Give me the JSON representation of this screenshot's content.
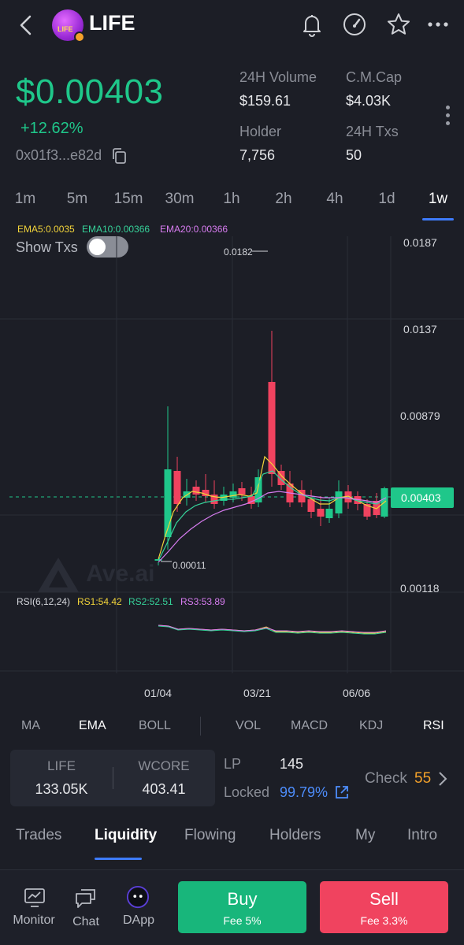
{
  "token": {
    "symbol": "LIFE",
    "logo_text": "LIFE",
    "price": "$0.00403",
    "change": "+12.62%",
    "address": "0x01f3...e82d"
  },
  "stats": {
    "volume_label": "24H Volume",
    "volume_value": "$159.61",
    "cap_label": "C.M.Cap",
    "cap_value": "$4.03K",
    "holder_label": "Holder",
    "holder_value": "7,756",
    "txs_label": "24H Txs",
    "txs_value": "50"
  },
  "timeframes": [
    "1m",
    "5m",
    "15m",
    "30m",
    "1h",
    "2h",
    "4h",
    "1d",
    "1w"
  ],
  "active_timeframe": "1w",
  "chart": {
    "show_txs_label": "Show Txs",
    "ema5": "EMA5:0.0035",
    "ema10": "EMA10:0.00366",
    "ema20": "EMA20:0.00366",
    "watermark": "Ave.ai",
    "high_label": "0.0182",
    "low_label": "0.00011",
    "price_tag": "0.00403",
    "rsi_label": "RSI(6,12,24)",
    "rs1": "RS1:54.42",
    "rs2": "RS2:52.51",
    "rs3": "RS3:53.89"
  },
  "chart_data": {
    "type": "candlestick",
    "y_tick_labels": [
      "0.0187",
      "0.0137",
      "0.00879",
      "0.00403",
      "0.00118"
    ],
    "x_tick_labels": [
      "01/04",
      "03/21",
      "06/06"
    ],
    "current_price": 0.00403,
    "high": 0.0182,
    "low": 0.00011,
    "colors": {
      "up": "#1fc78a",
      "down": "#f0435f",
      "ema5": "#f2d43a",
      "ema10": "#36d39a",
      "ema20": "#d77cf0"
    }
  },
  "indicators": [
    "MA",
    "EMA",
    "BOLL",
    "VOL",
    "MACD",
    "KDJ",
    "RSI"
  ],
  "liquidity": {
    "left_label": "LIFE",
    "left_value": "133.05K",
    "right_label": "WCORE",
    "right_value": "403.41",
    "lp_label": "LP",
    "lp_value": "145",
    "locked_label": "Locked",
    "locked_value": "99.79%",
    "check_label": "Check",
    "check_value": "55"
  },
  "bottom_tabs": [
    "Trades",
    "Liquidity",
    "Flowing",
    "Holders",
    "My",
    "Intro"
  ],
  "footer": {
    "monitor": "Monitor",
    "chat": "Chat",
    "dapp": "DApp",
    "buy": "Buy",
    "buy_fee": "Fee 5%",
    "sell": "Sell",
    "sell_fee": "Fee 3.3%"
  }
}
